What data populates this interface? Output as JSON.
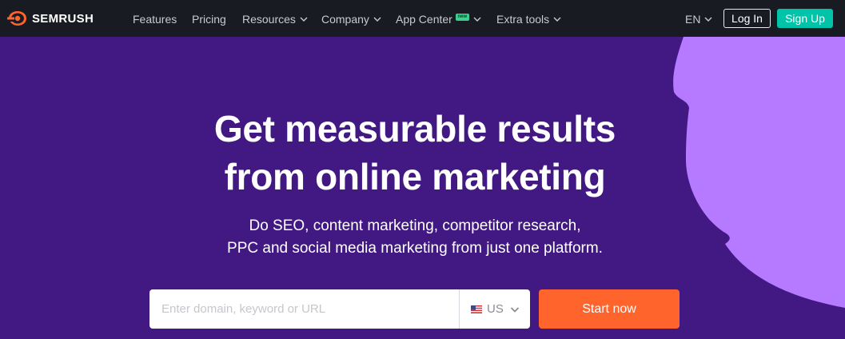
{
  "brand": {
    "name": "SEMRUSH",
    "accent": "#ff642d"
  },
  "nav": {
    "items": [
      {
        "label": "Features",
        "dropdown": false
      },
      {
        "label": "Pricing",
        "dropdown": false
      },
      {
        "label": "Resources",
        "dropdown": true
      },
      {
        "label": "Company",
        "dropdown": true
      },
      {
        "label": "App Center",
        "dropdown": true,
        "badge": "new"
      },
      {
        "label": "Extra tools",
        "dropdown": true
      }
    ],
    "language": "EN",
    "login_label": "Log In",
    "signup_label": "Sign Up"
  },
  "hero": {
    "headline_line1": "Get measurable results",
    "headline_line2": "from online marketing",
    "sub_line1": "Do SEO, content marketing, competitor research,",
    "sub_line2": "PPC and social media marketing from just one platform.",
    "search_placeholder": "Enter domain, keyword or URL",
    "database": "US",
    "database_flag_icon": "us-flag-icon",
    "cta_label": "Start now"
  },
  "colors": {
    "hero_bg": "#421983",
    "blob": "#b57aff",
    "signup": "#00c4a7",
    "cta": "#ff642d",
    "nav_bg": "#191b23"
  }
}
